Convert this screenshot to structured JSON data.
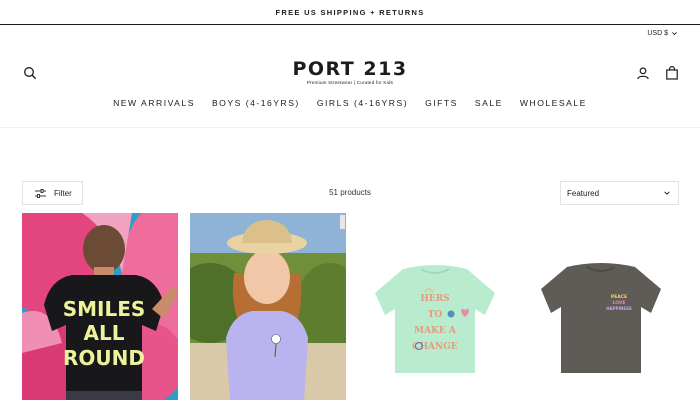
{
  "announcement": "FREE US SHIPPING + RETURNS",
  "currency": {
    "label": "USD $",
    "icon": "chevron-down-icon"
  },
  "header": {
    "logo_main": "PORT 213",
    "logo_tagline": "Premium Streetwear | Curated for Kids",
    "icons": [
      "search-icon",
      "account-icon",
      "cart-icon"
    ]
  },
  "nav": [
    "NEW ARRIVALS",
    "BOYS (4-16YRS)",
    "GIRLS (4-16YRS)",
    "GIFTS",
    "SALE",
    "WHOLESALE"
  ],
  "toolbar": {
    "filter_label": "Filter",
    "product_count": "51 products",
    "sort_selected": "Featured"
  },
  "products": [
    {
      "image": "boy wearing black 'Smiles All Round' tee in front of floral mural",
      "print_lines": [
        "SMILES",
        "ALL",
        "ROUND"
      ]
    },
    {
      "image": "girl in straw hat wearing lavender tee"
    },
    {
      "image": "mint green tee flat lay",
      "print_lines": [
        "HERS",
        "TO",
        "MAKE A",
        "CHANGE"
      ]
    },
    {
      "image": "washed grey tee flat lay",
      "print_lines": [
        "PEACE",
        "LOVE",
        "HAPPINESS"
      ]
    }
  ],
  "colors": {
    "text": "#1c1c1c",
    "border": "#e3e3e3",
    "mint": "#b9ebcf",
    "grey_tee": "#5f5b57",
    "black_tee": "#18181a"
  }
}
